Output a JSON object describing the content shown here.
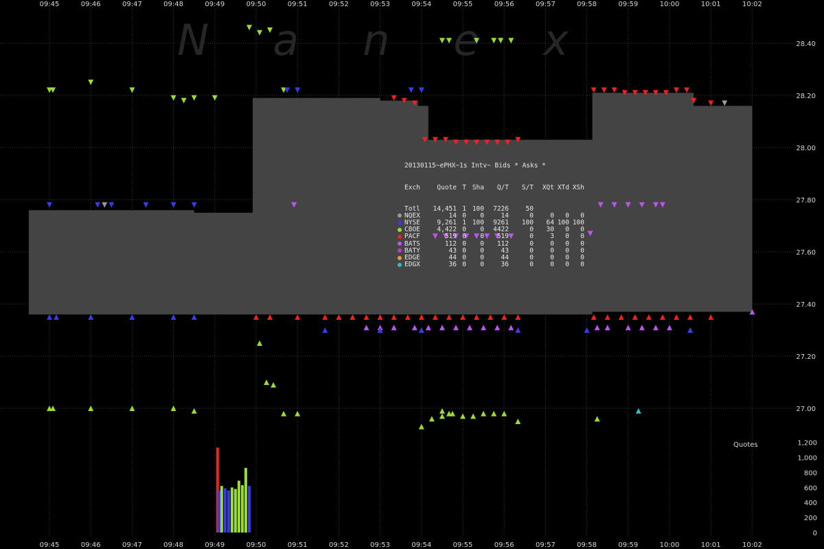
{
  "chart_data": {
    "type": "scatter",
    "title": "",
    "watermark": "Nanex",
    "x_axis": {
      "ticks": [
        "09:45",
        "09:46",
        "09:47",
        "09:48",
        "09:49",
        "09:50",
        "09:51",
        "09:52",
        "09:53",
        "09:54",
        "09:55",
        "09:56",
        "09:57",
        "09:58",
        "09:59",
        "10:00",
        "10:01",
        "10:02"
      ],
      "range": [
        "09:44:30",
        "10:02:15"
      ]
    },
    "y_axis_price": {
      "ticks": [
        "28.40",
        "28.20",
        "28.00",
        "27.80",
        "27.60",
        "27.40",
        "27.20",
        "27.00"
      ],
      "range": [
        26.94,
        28.46
      ]
    },
    "y_axis_quotes": {
      "label": "Quotes",
      "ticks": [
        "1,200",
        "1,000",
        "800",
        "600",
        "400",
        "200",
        "0"
      ],
      "range": [
        0,
        1200
      ]
    },
    "series_colors": {
      "NQEX": "#9a9a9a",
      "NYSE": "#3a3ae8",
      "CBOE": "#99dd33",
      "PACF": "#ee2222",
      "BATS": "#bb55ee",
      "BATY": "#cc33cc",
      "EDGE": "#ee9933",
      "EDGX": "#33bbcc",
      "spread_fill": "#444444",
      "grid": "#3a3a3a"
    },
    "nbbo_spread": [
      {
        "t": "09:44:30",
        "bid": 27.36,
        "ask": 27.76
      },
      {
        "t": "09:46:00",
        "bid": 27.36,
        "ask": 27.76
      },
      {
        "t": "09:47:30",
        "bid": 27.36,
        "ask": 27.76
      },
      {
        "t": "09:48:30",
        "bid": 27.36,
        "ask": 27.75
      },
      {
        "t": "09:49:15",
        "bid": 27.36,
        "ask": 27.75
      },
      {
        "t": "09:49:55",
        "bid": 27.36,
        "ask": 28.19
      },
      {
        "t": "09:51:30",
        "bid": 27.36,
        "ask": 28.19
      },
      {
        "t": "09:53:00",
        "bid": 27.36,
        "ask": 28.18
      },
      {
        "t": "09:53:55",
        "bid": 27.36,
        "ask": 28.16
      },
      {
        "t": "09:54:10",
        "bid": 27.36,
        "ask": 28.03
      },
      {
        "t": "09:56:00",
        "bid": 27.36,
        "ask": 28.03
      },
      {
        "t": "09:56:30",
        "bid": 27.36,
        "ask": 28.03
      },
      {
        "t": "09:57:30",
        "bid": 27.36,
        "ask": 28.03
      },
      {
        "t": "09:58:05",
        "bid": 27.36,
        "ask": 28.03
      },
      {
        "t": "09:58:08",
        "bid": 27.37,
        "ask": 28.21
      },
      {
        "t": "10:00:30",
        "bid": 27.37,
        "ask": 28.21
      },
      {
        "t": "10:00:35",
        "bid": 27.37,
        "ask": 28.16
      },
      {
        "t": "10:02:00",
        "bid": 27.37,
        "ask": 28.16
      }
    ],
    "asks": [
      {
        "ex": "CBOE",
        "t": "09:45:00",
        "p": 28.22
      },
      {
        "ex": "CBOE",
        "t": "09:45:05",
        "p": 28.22
      },
      {
        "ex": "CBOE",
        "t": "09:46:00",
        "p": 28.25
      },
      {
        "ex": "CBOE",
        "t": "09:47:00",
        "p": 28.22
      },
      {
        "ex": "CBOE",
        "t": "09:48:00",
        "p": 28.19
      },
      {
        "ex": "CBOE",
        "t": "09:48:15",
        "p": 28.18
      },
      {
        "ex": "CBOE",
        "t": "09:48:30",
        "p": 28.19
      },
      {
        "ex": "CBOE",
        "t": "09:49:00",
        "p": 28.19
      },
      {
        "ex": "CBOE",
        "t": "09:49:50",
        "p": 28.46
      },
      {
        "ex": "CBOE",
        "t": "09:50:05",
        "p": 28.44
      },
      {
        "ex": "CBOE",
        "t": "09:50:20",
        "p": 28.45
      },
      {
        "ex": "CBOE",
        "t": "09:50:40",
        "p": 28.22
      },
      {
        "ex": "CBOE",
        "t": "09:54:30",
        "p": 28.41
      },
      {
        "ex": "CBOE",
        "t": "09:54:40",
        "p": 28.41
      },
      {
        "ex": "CBOE",
        "t": "09:55:20",
        "p": 28.41
      },
      {
        "ex": "CBOE",
        "t": "09:55:45",
        "p": 28.41
      },
      {
        "ex": "CBOE",
        "t": "09:55:55",
        "p": 28.41
      },
      {
        "ex": "CBOE",
        "t": "09:56:10",
        "p": 28.41
      },
      {
        "ex": "NYSE",
        "t": "09:50:45",
        "p": 28.22
      },
      {
        "ex": "NYSE",
        "t": "09:51:00",
        "p": 28.22
      },
      {
        "ex": "NYSE",
        "t": "09:53:45",
        "p": 28.22
      },
      {
        "ex": "NYSE",
        "t": "09:54:00",
        "p": 28.22
      },
      {
        "ex": "PACF",
        "t": "09:53:20",
        "p": 28.19
      },
      {
        "ex": "PACF",
        "t": "09:53:35",
        "p": 28.18
      },
      {
        "ex": "PACF",
        "t": "09:53:50",
        "p": 28.17
      },
      {
        "ex": "PACF",
        "t": "09:54:05",
        "p": 28.03
      },
      {
        "ex": "PACF",
        "t": "09:54:20",
        "p": 28.03
      },
      {
        "ex": "PACF",
        "t": "09:54:35",
        "p": 28.03
      },
      {
        "ex": "PACF",
        "t": "09:54:50",
        "p": 28.02
      },
      {
        "ex": "PACF",
        "t": "09:55:05",
        "p": 28.02
      },
      {
        "ex": "PACF",
        "t": "09:55:20",
        "p": 28.02
      },
      {
        "ex": "PACF",
        "t": "09:55:35",
        "p": 28.02
      },
      {
        "ex": "PACF",
        "t": "09:55:50",
        "p": 28.02
      },
      {
        "ex": "PACF",
        "t": "09:56:05",
        "p": 28.02
      },
      {
        "ex": "PACF",
        "t": "09:56:20",
        "p": 28.03
      },
      {
        "ex": "PACF",
        "t": "09:58:10",
        "p": 28.22
      },
      {
        "ex": "PACF",
        "t": "09:58:25",
        "p": 28.22
      },
      {
        "ex": "PACF",
        "t": "09:58:40",
        "p": 28.22
      },
      {
        "ex": "PACF",
        "t": "09:58:55",
        "p": 28.21
      },
      {
        "ex": "PACF",
        "t": "09:59:10",
        "p": 28.21
      },
      {
        "ex": "PACF",
        "t": "09:59:25",
        "p": 28.21
      },
      {
        "ex": "PACF",
        "t": "09:59:40",
        "p": 28.21
      },
      {
        "ex": "PACF",
        "t": "09:59:55",
        "p": 28.21
      },
      {
        "ex": "PACF",
        "t": "10:00:10",
        "p": 28.22
      },
      {
        "ex": "PACF",
        "t": "10:00:25",
        "p": 28.22
      },
      {
        "ex": "PACF",
        "t": "10:00:35",
        "p": 28.18
      },
      {
        "ex": "PACF",
        "t": "10:01:00",
        "p": 28.17
      },
      {
        "ex": "NQEX",
        "t": "10:01:20",
        "p": 28.17
      },
      {
        "ex": "NYSE",
        "t": "09:45:00",
        "p": 27.78
      },
      {
        "ex": "NYSE",
        "t": "09:46:10",
        "p": 27.78
      },
      {
        "ex": "NYSE",
        "t": "09:46:30",
        "p": 27.78
      },
      {
        "ex": "NYSE",
        "t": "09:47:20",
        "p": 27.78
      },
      {
        "ex": "NYSE",
        "t": "09:48:00",
        "p": 27.78
      },
      {
        "ex": "NYSE",
        "t": "09:48:30",
        "p": 27.78
      },
      {
        "ex": "NQEX",
        "t": "09:46:20",
        "p": 27.78
      },
      {
        "ex": "BATS",
        "t": "09:54:20",
        "p": 27.66
      },
      {
        "ex": "BATS",
        "t": "09:54:35",
        "p": 27.66
      },
      {
        "ex": "BATS",
        "t": "09:54:50",
        "p": 27.66
      },
      {
        "ex": "BATS",
        "t": "09:55:05",
        "p": 27.66
      },
      {
        "ex": "BATS",
        "t": "09:55:20",
        "p": 27.66
      },
      {
        "ex": "BATS",
        "t": "09:55:35",
        "p": 27.66
      },
      {
        "ex": "BATS",
        "t": "09:55:50",
        "p": 27.66
      },
      {
        "ex": "BATS",
        "t": "09:56:10",
        "p": 27.66
      },
      {
        "ex": "BATS",
        "t": "09:58:05",
        "p": 27.67
      },
      {
        "ex": "BATS",
        "t": "09:58:20",
        "p": 27.78
      },
      {
        "ex": "BATS",
        "t": "09:58:40",
        "p": 27.78
      },
      {
        "ex": "BATS",
        "t": "09:59:00",
        "p": 27.78
      },
      {
        "ex": "BATS",
        "t": "09:59:20",
        "p": 27.78
      },
      {
        "ex": "BATS",
        "t": "09:59:40",
        "p": 27.78
      },
      {
        "ex": "BATS",
        "t": "09:59:50",
        "p": 27.78
      },
      {
        "ex": "BATS",
        "t": "09:50:55",
        "p": 27.78
      }
    ],
    "bids": [
      {
        "ex": "NYSE",
        "t": "09:45:00",
        "p": 27.35
      },
      {
        "ex": "NYSE",
        "t": "09:45:10",
        "p": 27.35
      },
      {
        "ex": "NYSE",
        "t": "09:46:00",
        "p": 27.35
      },
      {
        "ex": "NYSE",
        "t": "09:47:00",
        "p": 27.35
      },
      {
        "ex": "NYSE",
        "t": "09:48:00",
        "p": 27.35
      },
      {
        "ex": "NYSE",
        "t": "09:48:30",
        "p": 27.35
      },
      {
        "ex": "CBOE",
        "t": "09:45:00",
        "p": 27.0
      },
      {
        "ex": "CBOE",
        "t": "09:45:05",
        "p": 27.0
      },
      {
        "ex": "CBOE",
        "t": "09:46:00",
        "p": 27.0
      },
      {
        "ex": "CBOE",
        "t": "09:47:00",
        "p": 27.0
      },
      {
        "ex": "CBOE",
        "t": "09:48:00",
        "p": 27.0
      },
      {
        "ex": "CBOE",
        "t": "09:48:30",
        "p": 26.99
      },
      {
        "ex": "CBOE",
        "t": "09:50:40",
        "p": 26.98
      },
      {
        "ex": "CBOE",
        "t": "09:51:00",
        "p": 26.98
      },
      {
        "ex": "CBOE",
        "t": "09:50:05",
        "p": 27.25
      },
      {
        "ex": "CBOE",
        "t": "09:50:15",
        "p": 27.1
      },
      {
        "ex": "CBOE",
        "t": "09:50:25",
        "p": 27.09
      },
      {
        "ex": "CBOE",
        "t": "09:54:00",
        "p": 26.93
      },
      {
        "ex": "CBOE",
        "t": "09:54:15",
        "p": 26.96
      },
      {
        "ex": "CBOE",
        "t": "09:54:30",
        "p": 26.97
      },
      {
        "ex": "CBOE",
        "t": "09:54:40",
        "p": 26.98
      },
      {
        "ex": "CBOE",
        "t": "09:54:30",
        "p": 26.99
      },
      {
        "ex": "CBOE",
        "t": "09:54:45",
        "p": 26.98
      },
      {
        "ex": "CBOE",
        "t": "09:55:00",
        "p": 26.97
      },
      {
        "ex": "CBOE",
        "t": "09:55:15",
        "p": 26.97
      },
      {
        "ex": "CBOE",
        "t": "09:55:30",
        "p": 26.98
      },
      {
        "ex": "CBOE",
        "t": "09:55:45",
        "p": 26.98
      },
      {
        "ex": "CBOE",
        "t": "09:56:00",
        "p": 26.98
      },
      {
        "ex": "CBOE",
        "t": "09:56:20",
        "p": 26.95
      },
      {
        "ex": "CBOE",
        "t": "09:58:15",
        "p": 26.96
      },
      {
        "ex": "EDGX",
        "t": "09:59:15",
        "p": 26.99
      },
      {
        "ex": "PACF",
        "t": "09:50:00",
        "p": 27.35
      },
      {
        "ex": "PACF",
        "t": "09:50:20",
        "p": 27.35
      },
      {
        "ex": "PACF",
        "t": "09:51:00",
        "p": 27.35
      },
      {
        "ex": "PACF",
        "t": "09:51:40",
        "p": 27.35
      },
      {
        "ex": "PACF",
        "t": "09:52:00",
        "p": 27.35
      },
      {
        "ex": "PACF",
        "t": "09:52:20",
        "p": 27.35
      },
      {
        "ex": "PACF",
        "t": "09:52:40",
        "p": 27.35
      },
      {
        "ex": "PACF",
        "t": "09:53:00",
        "p": 27.35
      },
      {
        "ex": "PACF",
        "t": "09:53:20",
        "p": 27.35
      },
      {
        "ex": "PACF",
        "t": "09:53:40",
        "p": 27.35
      },
      {
        "ex": "PACF",
        "t": "09:54:00",
        "p": 27.35
      },
      {
        "ex": "PACF",
        "t": "09:54:20",
        "p": 27.35
      },
      {
        "ex": "PACF",
        "t": "09:54:40",
        "p": 27.35
      },
      {
        "ex": "PACF",
        "t": "09:55:00",
        "p": 27.35
      },
      {
        "ex": "PACF",
        "t": "09:55:20",
        "p": 27.35
      },
      {
        "ex": "PACF",
        "t": "09:55:40",
        "p": 27.35
      },
      {
        "ex": "PACF",
        "t": "09:56:00",
        "p": 27.35
      },
      {
        "ex": "PACF",
        "t": "09:56:20",
        "p": 27.35
      },
      {
        "ex": "PACF",
        "t": "09:58:10",
        "p": 27.35
      },
      {
        "ex": "PACF",
        "t": "09:58:30",
        "p": 27.35
      },
      {
        "ex": "PACF",
        "t": "09:58:50",
        "p": 27.35
      },
      {
        "ex": "PACF",
        "t": "09:59:10",
        "p": 27.35
      },
      {
        "ex": "PACF",
        "t": "09:59:30",
        "p": 27.35
      },
      {
        "ex": "PACF",
        "t": "09:59:50",
        "p": 27.35
      },
      {
        "ex": "PACF",
        "t": "10:00:10",
        "p": 27.35
      },
      {
        "ex": "PACF",
        "t": "10:00:30",
        "p": 27.35
      },
      {
        "ex": "PACF",
        "t": "10:01:00",
        "p": 27.35
      },
      {
        "ex": "BATS",
        "t": "09:52:40",
        "p": 27.31
      },
      {
        "ex": "BATS",
        "t": "09:53:00",
        "p": 27.31
      },
      {
        "ex": "BATS",
        "t": "09:53:20",
        "p": 27.31
      },
      {
        "ex": "BATS",
        "t": "09:53:50",
        "p": 27.31
      },
      {
        "ex": "BATS",
        "t": "09:54:10",
        "p": 27.31
      },
      {
        "ex": "BATS",
        "t": "09:54:30",
        "p": 27.31
      },
      {
        "ex": "BATS",
        "t": "09:54:50",
        "p": 27.31
      },
      {
        "ex": "BATS",
        "t": "09:55:10",
        "p": 27.31
      },
      {
        "ex": "BATS",
        "t": "09:55:30",
        "p": 27.31
      },
      {
        "ex": "BATS",
        "t": "09:55:50",
        "p": 27.31
      },
      {
        "ex": "BATS",
        "t": "09:56:10",
        "p": 27.31
      },
      {
        "ex": "BATS",
        "t": "09:56:20",
        "p": 27.3
      },
      {
        "ex": "BATS",
        "t": "09:58:15",
        "p": 27.31
      },
      {
        "ex": "BATS",
        "t": "09:58:30",
        "p": 27.31
      },
      {
        "ex": "BATS",
        "t": "09:59:00",
        "p": 27.31
      },
      {
        "ex": "BATS",
        "t": "09:59:20",
        "p": 27.31
      },
      {
        "ex": "BATS",
        "t": "09:59:40",
        "p": 27.31
      },
      {
        "ex": "BATS",
        "t": "10:00:00",
        "p": 27.31
      },
      {
        "ex": "BATS",
        "t": "10:00:30",
        "p": 27.3
      },
      {
        "ex": "NYSE",
        "t": "09:51:40",
        "p": 27.3
      },
      {
        "ex": "NYSE",
        "t": "09:53:00",
        "p": 27.3
      },
      {
        "ex": "NYSE",
        "t": "09:54:00",
        "p": 27.3
      },
      {
        "ex": "NYSE",
        "t": "09:56:20",
        "p": 27.3
      },
      {
        "ex": "NYSE",
        "t": "09:58:00",
        "p": 27.3
      },
      {
        "ex": "NYSE",
        "t": "10:00:30",
        "p": 27.3
      },
      {
        "ex": "BATS",
        "t": "10:02:00",
        "p": 27.37
      }
    ],
    "quote_bars": [
      {
        "t": "09:49:04",
        "v": 1130,
        "ex": "PACF"
      },
      {
        "t": "09:49:06",
        "v": 560,
        "ex": "NYSE"
      },
      {
        "t": "09:49:10",
        "v": 620,
        "ex": "CBOE"
      },
      {
        "t": "09:49:15",
        "v": 590,
        "ex": "NYSE"
      },
      {
        "t": "09:49:20",
        "v": 560,
        "ex": "NYSE"
      },
      {
        "t": "09:49:25",
        "v": 600,
        "ex": "CBOE"
      },
      {
        "t": "09:49:30",
        "v": 580,
        "ex": "CBOE"
      },
      {
        "t": "09:49:35",
        "v": 690,
        "ex": "CBOE"
      },
      {
        "t": "09:49:40",
        "v": 630,
        "ex": "CBOE"
      },
      {
        "t": "09:49:45",
        "v": 860,
        "ex": "CBOE"
      },
      {
        "t": "09:49:50",
        "v": 620,
        "ex": "NYSE"
      }
    ]
  },
  "stats_table": {
    "title": "20130115~ePHX~1s Intv~ Bids * Asks *",
    "headers": [
      "Exch",
      "Quote",
      "T",
      "Sha",
      "Q/T",
      "S/T",
      "XQt",
      "XTd",
      "XSh"
    ],
    "rows": [
      {
        "exch": "Totl",
        "quote": "14,451",
        "t": "1",
        "sha": "100",
        "qt": "7226",
        "st": "50",
        "xqt": "",
        "xtd": "",
        "xsh": "",
        "color": ""
      },
      {
        "exch": "NQEX",
        "quote": "14",
        "t": "0",
        "sha": "0",
        "qt": "14",
        "st": "0",
        "xqt": "0",
        "xtd": "0",
        "xsh": "0",
        "color": "#9a9a9a"
      },
      {
        "exch": "NYSE",
        "quote": "9,261",
        "t": "1",
        "sha": "100",
        "qt": "9261",
        "st": "100",
        "xqt": "64",
        "xtd": "100",
        "xsh": "100",
        "color": "#3a3ae8"
      },
      {
        "exch": "CBOE",
        "quote": "4,422",
        "t": "0",
        "sha": "0",
        "qt": "4422",
        "st": "0",
        "xqt": "30",
        "xtd": "0",
        "xsh": "0",
        "color": "#99dd33"
      },
      {
        "exch": "PACF",
        "quote": "519",
        "t": "0",
        "sha": "0",
        "qt": "519",
        "st": "0",
        "xqt": "3",
        "xtd": "0",
        "xsh": "0",
        "color": "#ee2222"
      },
      {
        "exch": "BATS",
        "quote": "112",
        "t": "0",
        "sha": "0",
        "qt": "112",
        "st": "0",
        "xqt": "0",
        "xtd": "0",
        "xsh": "0",
        "color": "#bb55ee"
      },
      {
        "exch": "BATY",
        "quote": "43",
        "t": "0",
        "sha": "0",
        "qt": "43",
        "st": "0",
        "xqt": "0",
        "xtd": "0",
        "xsh": "0",
        "color": "#cc33cc"
      },
      {
        "exch": "EDGE",
        "quote": "44",
        "t": "0",
        "sha": "0",
        "qt": "44",
        "st": "0",
        "xqt": "0",
        "xtd": "0",
        "xsh": "0",
        "color": "#ee9933"
      },
      {
        "exch": "EDGX",
        "quote": "36",
        "t": "0",
        "sha": "0",
        "qt": "36",
        "st": "0",
        "xqt": "0",
        "xtd": "0",
        "xsh": "0",
        "color": "#33bbcc"
      }
    ]
  }
}
